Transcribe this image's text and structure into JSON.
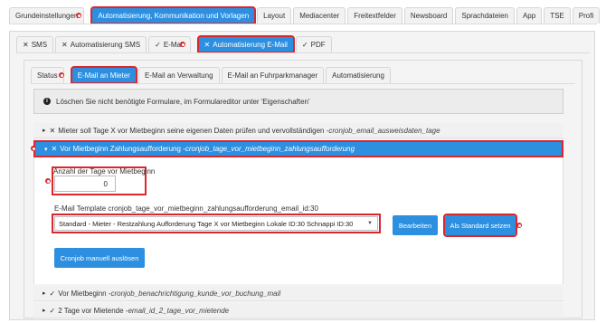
{
  "top_tabs": [
    {
      "label": "Grundeinstellungen",
      "active": false
    },
    {
      "label": "Automatisierung, Kommunikation und Vorlagen",
      "active": true
    },
    {
      "label": "Layout",
      "active": false
    },
    {
      "label": "Mediacenter",
      "active": false
    },
    {
      "label": "Freitextfelder",
      "active": false
    },
    {
      "label": "Newsboard",
      "active": false
    },
    {
      "label": "Sprachdateien",
      "active": false
    },
    {
      "label": "App",
      "active": false
    },
    {
      "label": "TSE",
      "active": false
    },
    {
      "label": "Profi",
      "active": false
    }
  ],
  "second_tabs": [
    {
      "mark": "✕",
      "label": "SMS",
      "active": false
    },
    {
      "mark": "✕",
      "label": "Automatisierung SMS",
      "active": false
    },
    {
      "mark": "✓",
      "label": "E-Mail",
      "active": false
    },
    {
      "mark": "✕",
      "label": "Automatisierung E-Mail",
      "active": true
    },
    {
      "mark": "✓",
      "label": "PDF",
      "active": false
    }
  ],
  "third_tabs": [
    {
      "label": "Status",
      "active": false
    },
    {
      "label": "E-Mail an Mieter",
      "active": true
    },
    {
      "label": "E-Mail an Verwaltung",
      "active": false
    },
    {
      "label": "E-Mail an Fuhrparkmanager",
      "active": false
    },
    {
      "label": "Automatisierung",
      "active": false
    }
  ],
  "info": {
    "text": "Löschen Sie nicht benötigte Formulare, im Formulareditor unter 'Eigenschaften'"
  },
  "accordion": {
    "row1": {
      "chevron": "▸",
      "mark": "✕",
      "title": "Mieter soll Tage X vor Mietbeginn seine eigenen Daten prüfen und vervollständigen - ",
      "code": "cronjob_email_ausweisdaten_tage"
    },
    "row2": {
      "chevron": "▾",
      "mark": "✕",
      "title": "Vor Mietbeginn Zahlungsaufforderung - ",
      "code": "cronjob_tage_vor_mietbeginn_zahlungsaufforderung"
    },
    "row3": {
      "chevron": "▸",
      "mark": "✓",
      "title": "Vor Mietbeginn - ",
      "code": "cronjob_benachrichtigung_kunde_vor_buchung_mail"
    },
    "row4": {
      "chevron": "▸",
      "mark": "✓",
      "title": "2 Tage vor Mietende - ",
      "code": "email_id_2_tage_vor_mietende"
    }
  },
  "form": {
    "days_label": "Anzahl der Tage vor Mietbeginn",
    "days_value": "0",
    "template_label": "E-Mail Template cronjob_tage_vor_mietbeginn_zahlungsaufforderung_email_id:30",
    "template_selected": "Standard - Mieter - Restzahlung Aufforderung Tage X vor Mietbeginn Lokale ID:30 Schnappi ID:30",
    "edit_button": "Bearbeiten",
    "default_button": "Als Standard setzen",
    "trigger_button": "Cronjob manuell auslösen"
  },
  "colors": {
    "accent": "#2d8fe0",
    "highlight_red": "#d9272e"
  }
}
